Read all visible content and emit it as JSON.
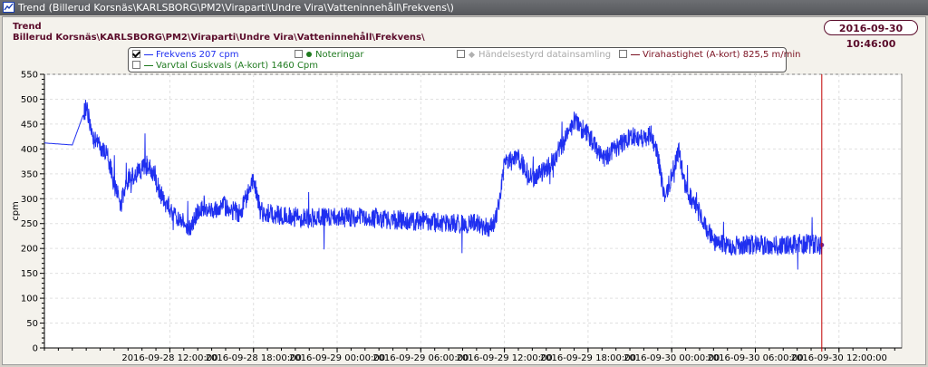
{
  "window": {
    "title": "Trend (Billerud Korsnäs\\KARLSBORG\\PM2\\Viraparti\\Undre Vira\\Vatteninnehåll\\Frekvens\\)"
  },
  "header": {
    "title": "Trend",
    "path": "Billerud Korsnäs\\KARLSBORG\\PM2\\Viraparti\\Undre Vira\\Vatteninnehåll\\Frekvens\\",
    "datetime": "2016-09-30 10:46:00"
  },
  "legend": {
    "items": [
      {
        "label": "Frekvens 207 cpm",
        "checked": true,
        "color": "#1f2ff0",
        "marker": "line"
      },
      {
        "label": "Noteringar",
        "checked": false,
        "color": "#1f7a1f",
        "marker": "dot"
      },
      {
        "label": "Händelsestyrd datainsamling",
        "checked": false,
        "color": "#a8a8a8",
        "marker": "diamond"
      },
      {
        "label": "Virahastighet (A-kort) 825,5 m/min",
        "checked": false,
        "color": "#7a1020",
        "marker": "line"
      },
      {
        "label": "Varvtal Guskvals (A-kort) 1460 Cpm",
        "checked": false,
        "color": "#1f7a1f",
        "marker": "line"
      }
    ]
  },
  "chart_data": {
    "type": "line",
    "ylabel": "cpm",
    "ylim": [
      0,
      550
    ],
    "yticks": [
      "0",
      "50",
      "100",
      "150",
      "200",
      "250",
      "300",
      "350",
      "400",
      "450",
      "500",
      "550"
    ],
    "xlim": [
      "2016-09-28 03:00:00",
      "2016-09-30 16:30:00"
    ],
    "xticks": [
      "2016-09-28 12:00:00",
      "2016-09-28 18:00:00",
      "2016-09-29 00:00:00",
      "2016-09-29 06:00:00",
      "2016-09-29 12:00:00",
      "2016-09-29 18:00:00",
      "2016-09-30 00:00:00",
      "2016-09-30 06:00:00",
      "2016-09-30 12:00:00"
    ],
    "grid": true,
    "cursor_time": "2016-09-30 10:46:00",
    "cursor_color": "#c00000",
    "series": [
      {
        "name": "Frekvens",
        "color": "#1f2ff0",
        "x": [
          "2016-09-28 03:00:00",
          "2016-09-28 05:00:00",
          "2016-09-28 06:00:00",
          "2016-09-28 06:30:00",
          "2016-09-28 07:30:00",
          "2016-09-28 08:00:00",
          "2016-09-28 08:30:00",
          "2016-09-28 09:00:00",
          "2016-09-28 10:30:00",
          "2016-09-28 11:30:00",
          "2016-09-28 12:30:00",
          "2016-09-28 13:30:00",
          "2016-09-28 14:00:00",
          "2016-09-28 14:30:00",
          "2016-09-28 15:00:00",
          "2016-09-28 16:00:00",
          "2016-09-28 17:00:00",
          "2016-09-28 18:00:00",
          "2016-09-28 18:30:00",
          "2016-09-28 19:00:00",
          "2016-09-28 20:00:00",
          "2016-09-28 22:00:00",
          "2016-09-29 00:00:00",
          "2016-09-29 02:00:00",
          "2016-09-29 04:00:00",
          "2016-09-29 06:00:00",
          "2016-09-29 08:00:00",
          "2016-09-29 10:00:00",
          "2016-09-29 11:00:00",
          "2016-09-29 11:30:00",
          "2016-09-29 12:00:00",
          "2016-09-29 13:00:00",
          "2016-09-29 14:00:00",
          "2016-09-29 15:00:00",
          "2016-09-29 16:00:00",
          "2016-09-29 17:00:00",
          "2016-09-29 18:00:00",
          "2016-09-29 19:00:00",
          "2016-09-29 20:00:00",
          "2016-09-29 21:00:00",
          "2016-09-29 22:00:00",
          "2016-09-29 22:30:00",
          "2016-09-29 23:00:00",
          "2016-09-29 23:30:00",
          "2016-09-30 00:30:00",
          "2016-09-30 01:00:00",
          "2016-09-30 02:00:00",
          "2016-09-30 03:00:00",
          "2016-09-30 04:00:00",
          "2016-09-30 06:00:00",
          "2016-09-30 08:00:00",
          "2016-09-30 09:30:00",
          "2016-09-30 10:46:00"
        ],
        "values": [
          412,
          408,
          485,
          420,
          390,
          330,
          290,
          340,
          370,
          300,
          260,
          240,
          275,
          285,
          280,
          285,
          270,
          335,
          275,
          270,
          265,
          262,
          262,
          262,
          258,
          255,
          250,
          250,
          240,
          270,
          370,
          380,
          340,
          360,
          400,
          455,
          430,
          380,
          400,
          425,
          420,
          430,
          385,
          300,
          395,
          320,
          270,
          215,
          205,
          208,
          205,
          210,
          207
        ]
      }
    ]
  }
}
